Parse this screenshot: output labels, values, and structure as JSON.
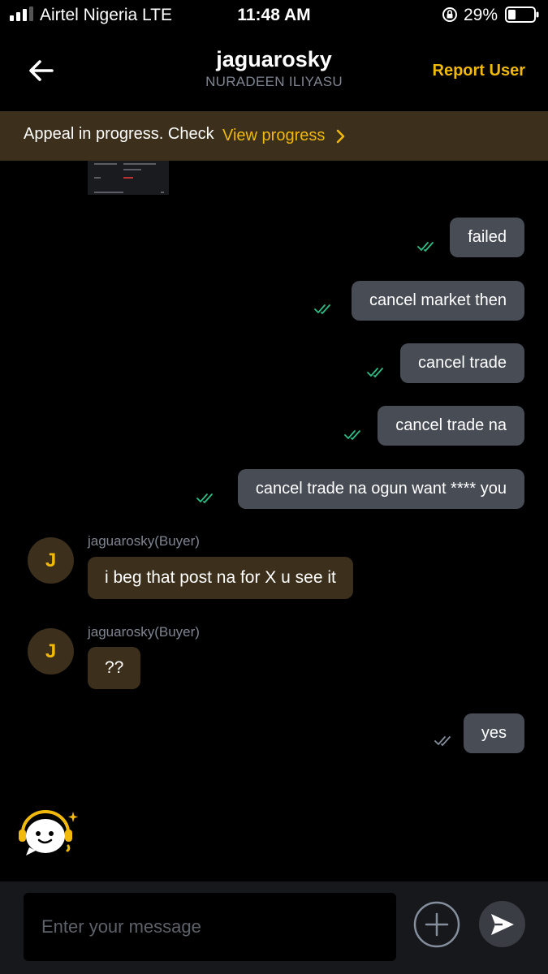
{
  "status_bar": {
    "carrier": "Airtel Nigeria  LTE",
    "time": "11:48 AM",
    "battery": "29%"
  },
  "header": {
    "title": "jaguarosky",
    "subtitle": "NURADEEN ILIYASU",
    "report_label": "Report User"
  },
  "banner": {
    "text": "Appeal in progress. Check",
    "link": "View progress"
  },
  "messages": [
    {
      "direction": "out",
      "text": "failed",
      "read": true
    },
    {
      "direction": "out",
      "text": "cancel market then",
      "read": true
    },
    {
      "direction": "out",
      "text": "cancel trade",
      "read": true
    },
    {
      "direction": "out",
      "text": "cancel trade na",
      "read": true
    },
    {
      "direction": "out",
      "text": "cancel trade na ogun want **** you",
      "read": true
    },
    {
      "direction": "in",
      "avatar": "J",
      "sender": "jaguarosky(Buyer)",
      "text": "i beg that post na for X u see it"
    },
    {
      "direction": "in",
      "avatar": "J",
      "sender": "jaguarosky(Buyer)",
      "text": "??"
    },
    {
      "direction": "out",
      "text": "yes",
      "read": false
    }
  ],
  "composer": {
    "placeholder": "Enter your message"
  },
  "colors": {
    "accent": "#f0b90b",
    "banner_bg": "#3c2f1b",
    "bubble_out": "#474c55",
    "check_read": "#2ebd85",
    "check_sent": "#848e9c"
  }
}
